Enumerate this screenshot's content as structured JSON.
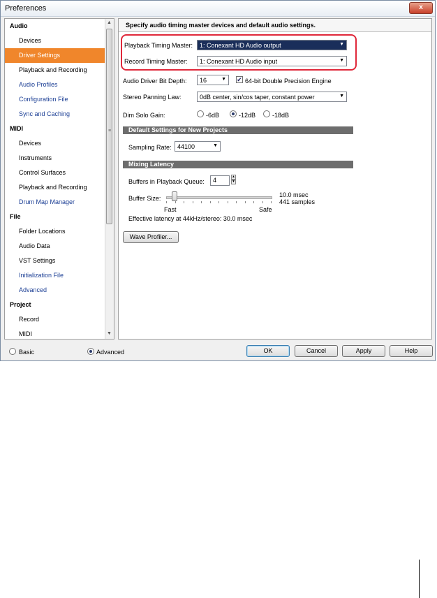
{
  "window": {
    "title": "Preferences",
    "close_label": "x"
  },
  "sidebar": {
    "groups": [
      {
        "label": "Audio",
        "items": [
          {
            "label": "Devices",
            "color": "dark"
          },
          {
            "label": "Driver Settings",
            "color": "dark",
            "selected": true
          },
          {
            "label": "Playback and Recording",
            "color": "dark"
          },
          {
            "label": "Audio Profiles",
            "color": "blue"
          },
          {
            "label": "Configuration File",
            "color": "blue"
          },
          {
            "label": "Sync and Caching",
            "color": "blue"
          }
        ]
      },
      {
        "label": "MIDI",
        "items": [
          {
            "label": "Devices",
            "color": "dark"
          },
          {
            "label": "Instruments",
            "color": "dark"
          },
          {
            "label": "Control Surfaces",
            "color": "dark"
          },
          {
            "label": "Playback and Recording",
            "color": "dark"
          },
          {
            "label": "Drum Map Manager",
            "color": "blue"
          }
        ]
      },
      {
        "label": "File",
        "items": [
          {
            "label": "Folder Locations",
            "color": "dark"
          },
          {
            "label": "Audio Data",
            "color": "dark"
          },
          {
            "label": "VST Settings",
            "color": "dark"
          },
          {
            "label": "Initialization File",
            "color": "blue"
          },
          {
            "label": "Advanced",
            "color": "blue"
          }
        ]
      },
      {
        "label": "Project",
        "items": [
          {
            "label": "Record",
            "color": "dark"
          },
          {
            "label": "MIDI",
            "color": "dark"
          }
        ]
      }
    ]
  },
  "main": {
    "header": "Specify audio timing master devices and default audio settings.",
    "playback_master_label": "Playback Timing Master:",
    "playback_master_value": "1: Conexant HD Audio output",
    "record_master_label": "Record Timing Master:",
    "record_master_value": "1: Conexant HD Audio input",
    "bit_depth_label": "Audio Driver Bit Depth:",
    "bit_depth_value": "16",
    "double_precision_label": "64-bit Double Precision Engine",
    "double_precision_checked": true,
    "panning_label": "Stereo Panning Law:",
    "panning_value": "0dB center, sin/cos taper, constant power",
    "dim_solo_label": "Dim Solo Gain:",
    "dim_solo_options": [
      "-6dB",
      "-12dB",
      "-18dB"
    ],
    "dim_solo_selected": "-12dB",
    "defaults_section": "Default Settings for New Projects",
    "sampling_label": "Sampling Rate:",
    "sampling_value": "44100",
    "latency_section": "Mixing Latency",
    "buffers_label": "Buffers in Playback Queue:",
    "buffers_value": "4",
    "buffer_size_label": "Buffer Size:",
    "buffer_msec": "10.0 msec",
    "buffer_samples": "441 samples",
    "buffer_position": 0.08,
    "fast_label": "Fast",
    "safe_label": "Safe",
    "effective_latency": "Effective latency at 44kHz/stereo:  30.0 msec",
    "wave_profiler_label": "Wave Profiler..."
  },
  "footer": {
    "basic_label": "Basic",
    "advanced_label": "Advanced",
    "mode_selected": "Advanced",
    "ok_label": "OK",
    "cancel_label": "Cancel",
    "apply_label": "Apply",
    "help_label": "Help"
  },
  "colors": {
    "selected_item": "#f0862b",
    "link_blue": "#1c3f95",
    "highlight_box": "#e0283a",
    "section_bar": "#6d6d6d"
  }
}
